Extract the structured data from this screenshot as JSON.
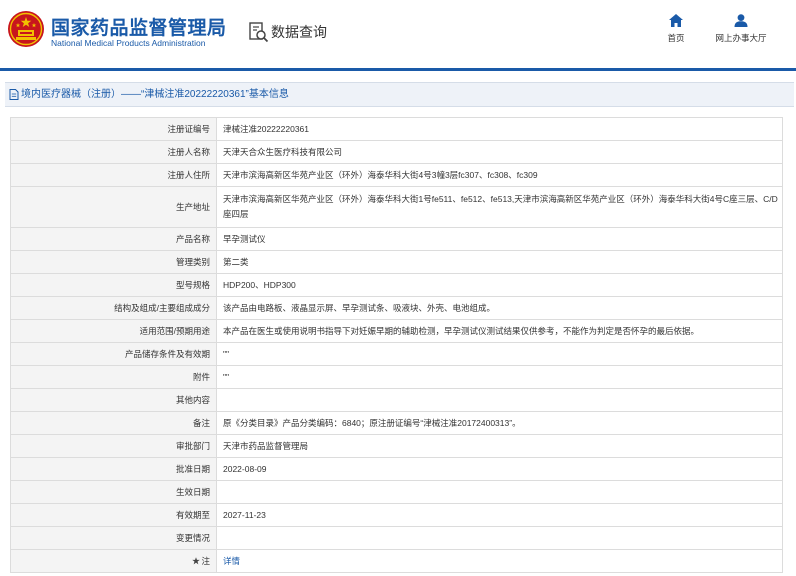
{
  "header": {
    "site_name_cn": "国家药品监督管理局",
    "site_name_en": "National Medical Products Administration",
    "page_heading": "数据查询",
    "nav": [
      {
        "label": "首页",
        "icon": "home-icon"
      },
      {
        "label": "网上办事大厅",
        "icon": "user-icon"
      }
    ],
    "colors": {
      "brand": "#1a5aa8",
      "emblem_red": "#c8161d",
      "emblem_gold": "#f2c200"
    }
  },
  "section": {
    "title": "境内医疗器械（注册）——“津械注准20222220361”基本信息"
  },
  "detail": {
    "rows": [
      {
        "label": "注册证编号",
        "value": "津械注准20222220361"
      },
      {
        "label": "注册人名称",
        "value": "天津天合众生医疗科技有限公司"
      },
      {
        "label": "注册人住所",
        "value": "天津市滨海高新区华苑产业区（环外）海泰华科大街4号3幢3层fc307、fc308、fc309"
      },
      {
        "label": "生产地址",
        "value": "天津市滨海高新区华苑产业区（环外）海泰华科大街1号fe511、fe512、fe513,天津市滨海高新区华苑产业区（环外）海泰华科大街4号C座三层、C/D座四层"
      },
      {
        "label": "产品名称",
        "value": "早孕测试仪"
      },
      {
        "label": "管理类别",
        "value": "第二类"
      },
      {
        "label": "型号规格",
        "value": "HDP200、HDP300"
      },
      {
        "label": "结构及组成/主要组成成分",
        "value": "该产品由电路板、液晶显示屏、早孕测试条、吸液块、外壳、电池组成。"
      },
      {
        "label": "适用范围/预期用途",
        "value": "本产品在医生或使用说明书指导下对妊娠早期的辅助检测，早孕测试仪测试结果仅供参考，不能作为判定是否怀孕的最后依据。"
      },
      {
        "label": "产品储存条件及有效期",
        "value": "\"\""
      },
      {
        "label": "附件",
        "value": "\"\""
      },
      {
        "label": "其他内容",
        "value": ""
      },
      {
        "label": "备注",
        "value": "原《分类目录》产品分类编码：6840；原注册证编号“津械注准20172400313”。"
      },
      {
        "label": "审批部门",
        "value": "天津市药品监督管理局"
      },
      {
        "label": "批准日期",
        "value": "2022-08-09"
      },
      {
        "label": "生效日期",
        "value": ""
      },
      {
        "label": "有效期至",
        "value": "2027-11-23"
      },
      {
        "label": "变更情况",
        "value": ""
      },
      {
        "label": "注",
        "value": "详情",
        "label_icon": "star-icon"
      }
    ]
  }
}
